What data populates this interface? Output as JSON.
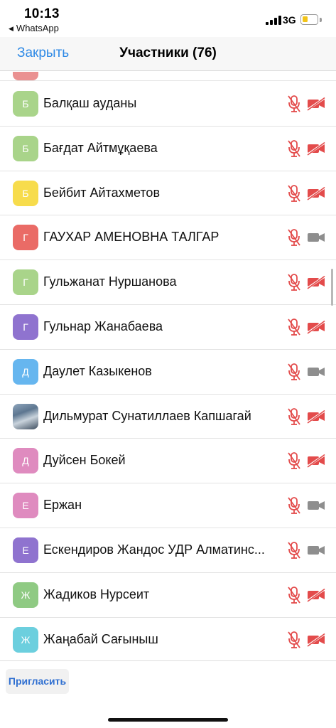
{
  "status_bar": {
    "time": "10:13",
    "back_app": "WhatsApp",
    "network": "3G",
    "battery_level": 0.4,
    "battery_color": "#f2c419"
  },
  "header": {
    "close_label": "Закрыть",
    "title": "Участники (76)",
    "accent_color": "#2f8ae6"
  },
  "participants": [
    {
      "initial": "Б",
      "color": "#a9d48a",
      "name": "Балқаш ауданы",
      "mic": "muted",
      "camera": "off"
    },
    {
      "initial": "Б",
      "color": "#a9d48a",
      "name": "Бағдат Айтмұқаева",
      "mic": "muted",
      "camera": "off"
    },
    {
      "initial": "Б",
      "color": "#f7dc4c",
      "name": "Бейбит Айтахметов",
      "mic": "muted",
      "camera": "off"
    },
    {
      "initial": "Г",
      "color": "#ea6b66",
      "name": "ГАУХАР АМЕНОВНА ТАЛГАР",
      "mic": "muted",
      "camera": "on"
    },
    {
      "initial": "Г",
      "color": "#a9d48a",
      "name": "Гульжанат Нуршанова",
      "mic": "muted",
      "camera": "off"
    },
    {
      "initial": "Г",
      "color": "#8f73cf",
      "name": "Гульнар Жанабаева",
      "mic": "muted",
      "camera": "off"
    },
    {
      "initial": "Д",
      "color": "#66b6ef",
      "name": "Даулет Казыкенов",
      "mic": "muted",
      "camera": "on"
    },
    {
      "initial": "",
      "color": "#6f8aa6",
      "name": "Дильмурат Сунатиллаев Капшагай",
      "mic": "muted",
      "camera": "off",
      "photo": true
    },
    {
      "initial": "Д",
      "color": "#df8bbf",
      "name": "Дуйсен Бокей",
      "mic": "muted",
      "camera": "off"
    },
    {
      "initial": "Е",
      "color": "#df8bbf",
      "name": "Ержан",
      "mic": "muted",
      "camera": "on"
    },
    {
      "initial": "Е",
      "color": "#8f73cf",
      "name": "Ескендиров Жандос УДР Алматинс...",
      "mic": "muted",
      "camera": "on"
    },
    {
      "initial": "Ж",
      "color": "#8fca83",
      "name": "Жадиков Нурсеит",
      "mic": "muted",
      "camera": "off"
    },
    {
      "initial": "Ж",
      "color": "#6ccfde",
      "name": "Жаңабай Сағыныш",
      "mic": "muted",
      "camera": "off"
    }
  ],
  "icon_colors": {
    "muted": "#e34b4b",
    "video_on": "#8e8e8e"
  },
  "footer": {
    "invite_label": "Пригласить"
  }
}
